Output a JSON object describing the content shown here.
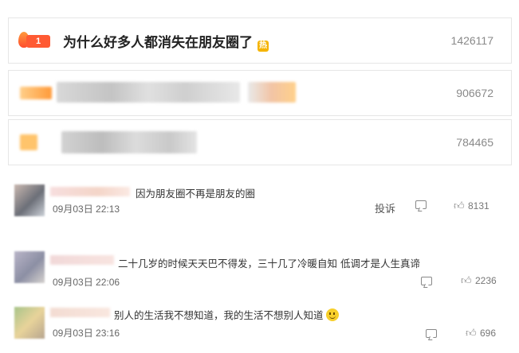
{
  "trending": [
    {
      "rank": "1",
      "title": "为什么好多人都消失在朋友圈了",
      "hot_tag": "热",
      "count": "1426117"
    },
    {
      "title": "",
      "count": "906672"
    },
    {
      "title": "",
      "count": "784465"
    }
  ],
  "comments": [
    {
      "text": "因为朋友圈不再是朋友的圈",
      "time": "09月03日 22:13",
      "report_label": "投诉",
      "likes": "8131"
    },
    {
      "text": "二十几岁的时候天天巴不得发，三十几了冷暖自知 低调才是人生真谛",
      "time": "09月03日 22:06",
      "likes": "2236"
    },
    {
      "text": "别人的生活我不想知道，我的生活不想别人知道",
      "time": "09月03日 23:16",
      "likes": "696"
    }
  ],
  "icons": {
    "flame": "flame-icon",
    "comment": "comment-icon",
    "like": "thumbs-up-icon",
    "emoji": "smile-emoji-icon"
  },
  "colors": {
    "rank_badge": "#ff5a33",
    "hot_tag": "#f5b400",
    "count_text": "#8a8a8a"
  }
}
